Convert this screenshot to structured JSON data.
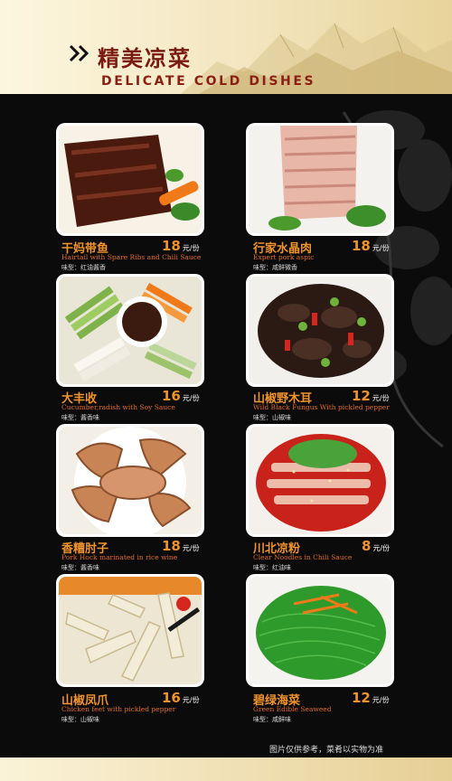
{
  "header": {
    "title_cn": "精美凉菜",
    "title_en": "DELICATE COLD DISHES"
  },
  "dishes": [
    {
      "name": "干妈带鱼",
      "price": "18",
      "unit": "元/份",
      "name_en": "Hairtail with Spare Ribs and Chili Sauce",
      "taste": "味型：红油酱香"
    },
    {
      "name": "行家水晶肉",
      "price": "18",
      "unit": "元/份",
      "name_en": "Expert pork aspic",
      "taste": "味型：咸鲜微香"
    },
    {
      "name": "大丰收",
      "price": "16",
      "unit": "元/份",
      "name_en": "Cucumber,radish  with Soy Sauce",
      "taste": "味型：酱香味"
    },
    {
      "name": "山椒野木耳",
      "price": "12",
      "unit": "元/份",
      "name_en": "Wild Black Fungus With pickled pepper",
      "taste": "味型：山椒味"
    },
    {
      "name": "香糟肘子",
      "price": "18",
      "unit": "元/份",
      "name_en": "Pork Hock marinated in rice wine",
      "taste": "味型：酱香味"
    },
    {
      "name": "川北凉粉",
      "price": "8",
      "unit": "元/份",
      "name_en": "Clear Noodles in Chili Sauce",
      "taste": "味型：红油味"
    },
    {
      "name": "山椒凤爪",
      "price": "16",
      "unit": "元/份",
      "name_en": "Chicken feet with pickled pepper",
      "taste": "味型：山椒味"
    },
    {
      "name": "碧绿海菜",
      "price": "12",
      "unit": "元/份",
      "name_en": "Green Edible Seaweed",
      "taste": "味型：咸鲜味"
    }
  ],
  "footer": {
    "note": "图片仅供参考，菜肴以实物为准"
  },
  "colors": {
    "accent": "#f0932c",
    "title": "#7a1a10",
    "background": "#0b0b0b"
  }
}
